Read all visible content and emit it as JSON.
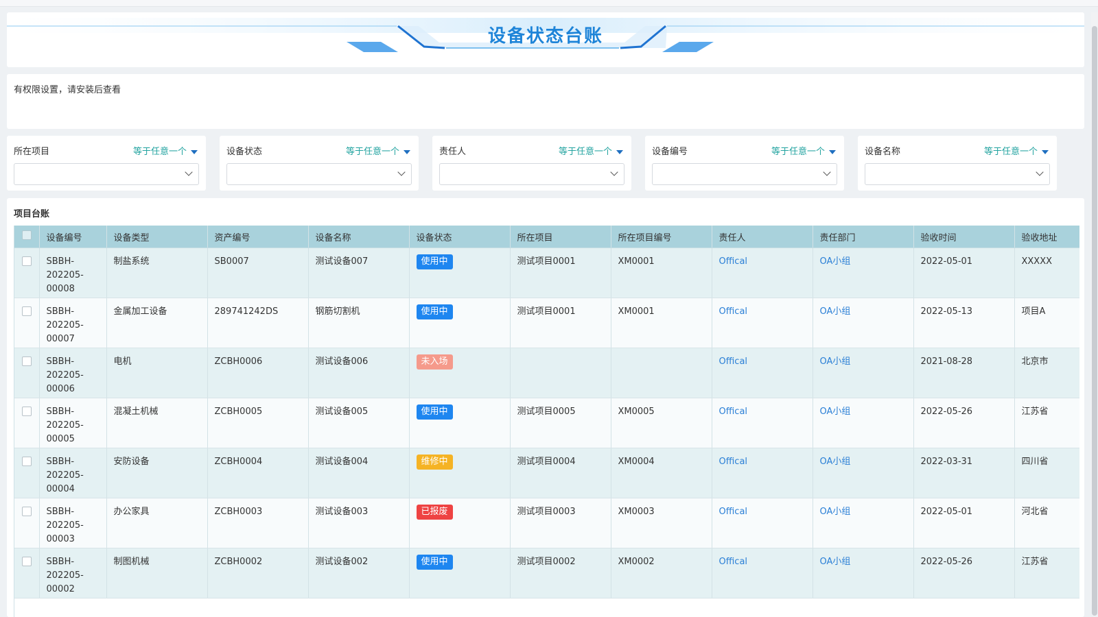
{
  "banner": {
    "title": "设备状态台账"
  },
  "notice": {
    "text": "有权限设置，请安装后查看"
  },
  "filters": [
    {
      "label": "所在项目",
      "operator": "等于任意一个"
    },
    {
      "label": "设备状态",
      "operator": "等于任意一个"
    },
    {
      "label": "责任人",
      "operator": "等于任意一个"
    },
    {
      "label": "设备编号",
      "operator": "等于任意一个"
    },
    {
      "label": "设备名称",
      "operator": "等于任意一个"
    }
  ],
  "table": {
    "title": "项目台账",
    "columns": [
      "设备编号",
      "设备类型",
      "资产编号",
      "设备名称",
      "设备状态",
      "所在项目",
      "所在项目编号",
      "责任人",
      "责任部门",
      "验收时间",
      "验收地址"
    ],
    "rows": [
      {
        "code": "SBBH-202205-00008",
        "type": "制盐系统",
        "asset": "SB0007",
        "name": "测试设备007",
        "status": "使用中",
        "project": "测试项目0001",
        "project_code": "XM0001",
        "owner": "Offical",
        "dept": "OA小组",
        "date": "2022-05-01",
        "address": "XXXXX"
      },
      {
        "code": "SBBH-202205-00007",
        "type": "金属加工设备",
        "asset": "289741242DS",
        "name": "钢筋切割机",
        "status": "使用中",
        "project": "测试项目0001",
        "project_code": "XM0001",
        "owner": "Offical",
        "dept": "OA小组",
        "date": "2022-05-13",
        "address": "项目A"
      },
      {
        "code": "SBBH-202205-00006",
        "type": "电机",
        "asset": "ZCBH0006",
        "name": "测试设备006",
        "status": "未入场",
        "project": "",
        "project_code": "",
        "owner": "Offical",
        "dept": "OA小组",
        "date": "2021-08-28",
        "address": "北京市"
      },
      {
        "code": "SBBH-202205-00005",
        "type": "混凝土机械",
        "asset": "ZCBH0005",
        "name": "测试设备005",
        "status": "使用中",
        "project": "测试项目0005",
        "project_code": "XM0005",
        "owner": "Offical",
        "dept": "OA小组",
        "date": "2022-05-26",
        "address": "江苏省"
      },
      {
        "code": "SBBH-202205-00004",
        "type": "安防设备",
        "asset": "ZCBH0004",
        "name": "测试设备004",
        "status": "维修中",
        "project": "测试项目0004",
        "project_code": "XM0004",
        "owner": "Offical",
        "dept": "OA小组",
        "date": "2022-03-31",
        "address": "四川省"
      },
      {
        "code": "SBBH-202205-00003",
        "type": "办公家具",
        "asset": "ZCBH0003",
        "name": "测试设备003",
        "status": "已报废",
        "project": "测试项目0003",
        "project_code": "XM0003",
        "owner": "Offical",
        "dept": "OA小组",
        "date": "2022-05-01",
        "address": "河北省"
      },
      {
        "code": "SBBH-202205-00002",
        "type": "制图机械",
        "asset": "ZCBH0002",
        "name": "测试设备002",
        "status": "使用中",
        "project": "测试项目0002",
        "project_code": "XM0002",
        "owner": "Offical",
        "dept": "OA小组",
        "date": "2022-05-26",
        "address": "江苏省"
      }
    ]
  },
  "status_colors": {
    "使用中": "#1e86f0",
    "未入场": "#f59a8b",
    "维修中": "#f5b324",
    "已报废": "#ee4343"
  },
  "colors": {
    "accent": "#1e84d8",
    "operator_text": "#22a3a0",
    "header_bg": "#a9d2dc",
    "link": "#2a7fd6"
  }
}
